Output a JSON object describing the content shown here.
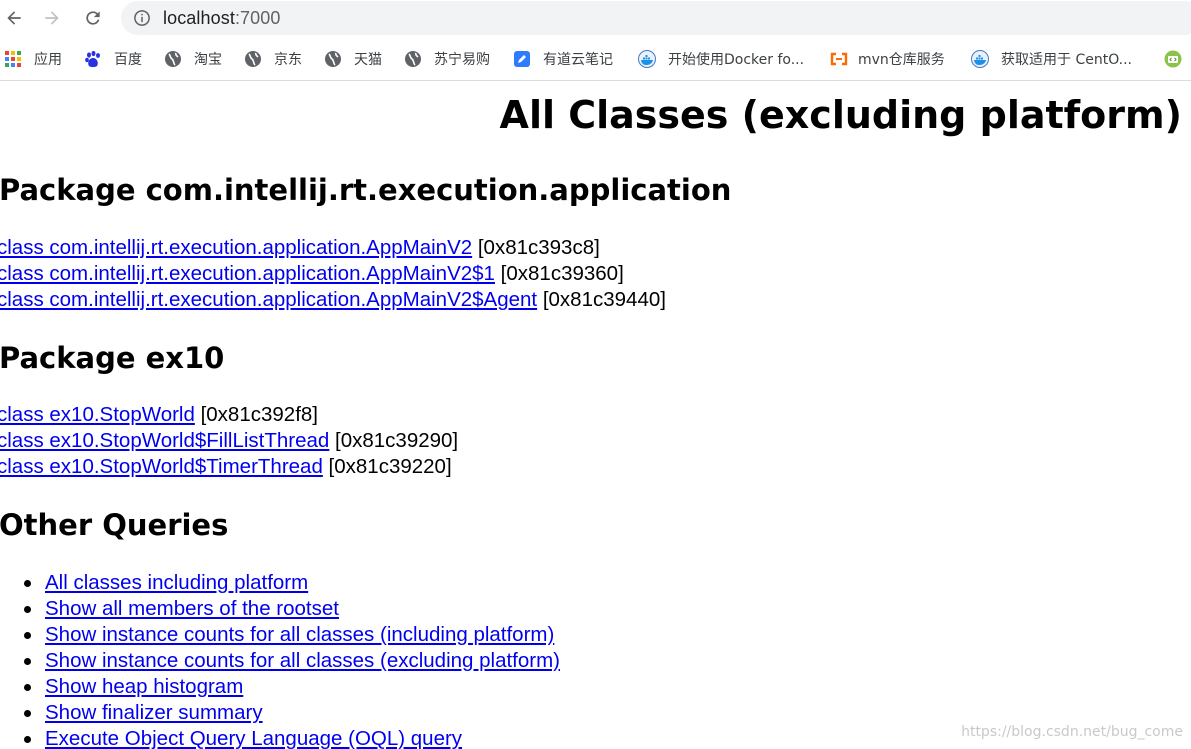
{
  "browser": {
    "url_host": "localhost",
    "url_port": ":7000",
    "back_icon": "arrow-left-icon",
    "forward_icon": "arrow-right-icon",
    "reload_icon": "reload-icon"
  },
  "bookmarks": [
    {
      "label": "应用",
      "icon": "apps-grid-icon"
    },
    {
      "label": "百度",
      "icon": "baidu-paw-icon"
    },
    {
      "label": "淘宝",
      "icon": "globe-icon"
    },
    {
      "label": "京东",
      "icon": "globe-icon"
    },
    {
      "label": "天猫",
      "icon": "globe-icon"
    },
    {
      "label": "苏宁易购",
      "icon": "globe-icon"
    },
    {
      "label": "有道云笔记",
      "icon": "note-icon"
    },
    {
      "label": "开始使用Docker fo...",
      "icon": "docker-icon"
    },
    {
      "label": "mvn仓库服务",
      "icon": "aliyun-icon"
    },
    {
      "label": "获取适用于 CentO...",
      "icon": "docker-icon"
    },
    {
      "label": "",
      "icon": "code-icon"
    }
  ],
  "page": {
    "title": "All Classes (excluding platform)",
    "packages": [
      {
        "heading": "Package com.intellij.rt.execution.application",
        "classes": [
          {
            "link": "class com.intellij.rt.execution.application.AppMainV2",
            "addr": " [0x81c393c8]"
          },
          {
            "link": "class com.intellij.rt.execution.application.AppMainV2$1",
            "addr": " [0x81c39360]"
          },
          {
            "link": "class com.intellij.rt.execution.application.AppMainV2$Agent",
            "addr": " [0x81c39440]"
          }
        ]
      },
      {
        "heading": "Package ex10",
        "classes": [
          {
            "link": "class ex10.StopWorld",
            "addr": " [0x81c392f8]"
          },
          {
            "link": "class ex10.StopWorld$FillListThread",
            "addr": " [0x81c39290]"
          },
          {
            "link": "class ex10.StopWorld$TimerThread",
            "addr": " [0x81c39220]"
          }
        ]
      }
    ],
    "other_heading": "Other Queries",
    "queries": [
      "All classes including platform",
      "Show all members of the rootset",
      "Show instance counts for all classes (including platform)",
      "Show instance counts for all classes (excluding platform)",
      "Show heap histogram",
      "Show finalizer summary",
      "Execute Object Query Language (OQL) query"
    ],
    "watermark": "https://blog.csdn.net/bug_come"
  },
  "colors": {
    "link": "#0000ee",
    "omnibox_bg": "#f1f3f4",
    "toolbar_icon": "#5f6368"
  }
}
